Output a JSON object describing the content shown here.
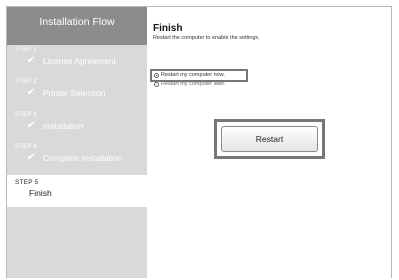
{
  "sidebar": {
    "header": "Installation Flow",
    "steps": [
      {
        "num": "STEP 1",
        "check": "✔",
        "label": "License Agreement"
      },
      {
        "num": "STEP 2",
        "check": "✔",
        "label": "Printer Selection"
      },
      {
        "num": "STEP 3",
        "check": "✔",
        "label": "Installation"
      },
      {
        "num": "STEP 4",
        "check": "✔",
        "label": "Complete Installation"
      }
    ],
    "current": {
      "num": "STEP 5",
      "label": "Finish"
    }
  },
  "main": {
    "title": "Finish",
    "subtitle": "Restart the computer to enable the settings.",
    "options": [
      {
        "label": "Restart my computer now.",
        "selected": true
      },
      {
        "label": "Restart my computer later.",
        "selected": false
      }
    ],
    "restart_label": "Restart"
  },
  "colors": {
    "sidebar_bg": "#d9d9d9",
    "header_bg": "#8c8c8c",
    "highlight_border": "#777777"
  }
}
